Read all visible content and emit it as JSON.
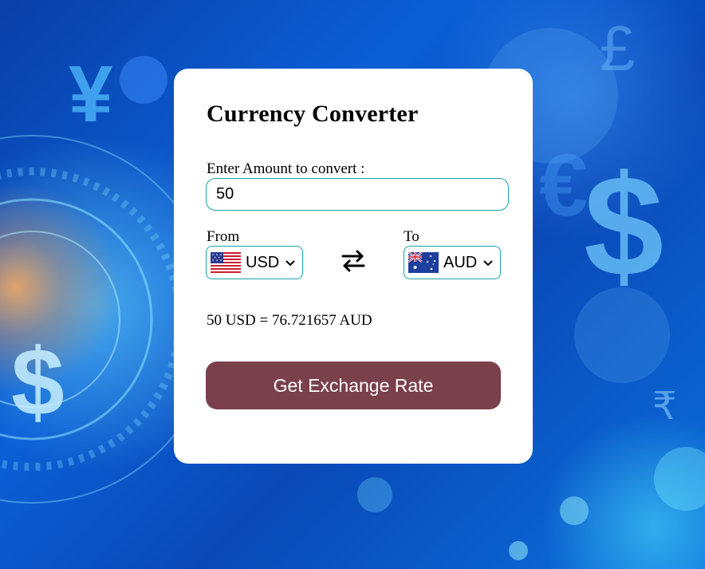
{
  "converter": {
    "title": "Currency Converter",
    "amount_label": "Enter Amount to convert :",
    "amount_value": "50",
    "from_label": "From",
    "to_label": "To",
    "from_currency": "USD",
    "to_currency": "AUD",
    "result_text": "50 USD = 76.721657 AUD",
    "button_label": "Get Exchange Rate"
  },
  "background_glyphs": {
    "yen": "¥",
    "pound": "£",
    "dollar": "$",
    "euro": "€",
    "rupee": "₹"
  },
  "icons": {
    "swap": "swap-arrows-icon",
    "from_flag": "us-flag-icon",
    "to_flag": "australia-flag-icon",
    "dropdown": "chevron-down-icon"
  },
  "colors": {
    "accent_border": "#1aa3a6",
    "button_bg": "#7a404c",
    "card_bg": "#ffffff"
  }
}
